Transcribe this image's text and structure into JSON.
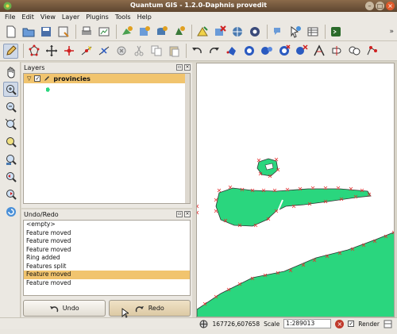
{
  "window": {
    "title": "Quantum GIS - 1.2.0-Daphnis provedit"
  },
  "menu": [
    "File",
    "Edit",
    "View",
    "Layer",
    "Plugins",
    "Tools",
    "Help"
  ],
  "layers_panel": {
    "title": "Layers",
    "layer_name": "provincies",
    "layer_visible": true
  },
  "undo_panel": {
    "title": "Undo/Redo",
    "items": [
      "<empty>",
      "Feature moved",
      "Feature moved",
      "Feature moved",
      "Ring added",
      "Features split",
      "Feature moved",
      "Feature moved"
    ],
    "selected_index": 6,
    "undo_label": "Undo",
    "redo_label": "Redo"
  },
  "status": {
    "coordinates": "167726,607658",
    "scale_label": "Scale",
    "scale_value": "1:289013",
    "render_label": "Render",
    "render_checked": true
  },
  "colors": {
    "polygon_fill": "#2ad67e",
    "vertex_marker": "#e53030",
    "selection": "#f1c46e"
  }
}
